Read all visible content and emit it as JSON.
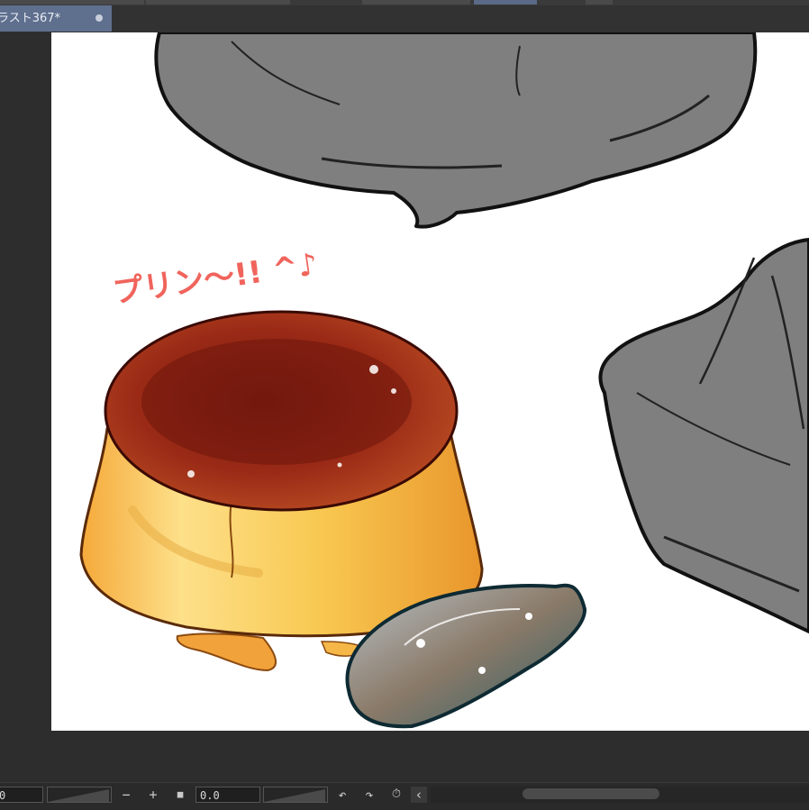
{
  "document_tab": {
    "title": "ラスト367*"
  },
  "artwork": {
    "caption": "プリン〜!! ^♪"
  },
  "statusbar": {
    "left_value": "0",
    "rotation_value": "0.0",
    "zoom_out_glyph": "−",
    "zoom_in_glyph": "+",
    "stop_glyph": "■",
    "rotate_left_glyph": "↶",
    "rotate_right_glyph": "↷",
    "reset_glyph": "⏱",
    "collapse_glyph": "‹"
  },
  "colors": {
    "accent_tab": "#5f6f8e",
    "caramel": "#8e2414",
    "custard": "#f6c24a",
    "sketch_gray": "#7f7f7f"
  },
  "icons": [
    "close-dot-icon",
    "zoom-out-icon",
    "zoom-in-icon",
    "stop-icon",
    "rotate-left-icon",
    "rotate-right-icon",
    "reset-rotation-icon",
    "collapse-icon"
  ]
}
